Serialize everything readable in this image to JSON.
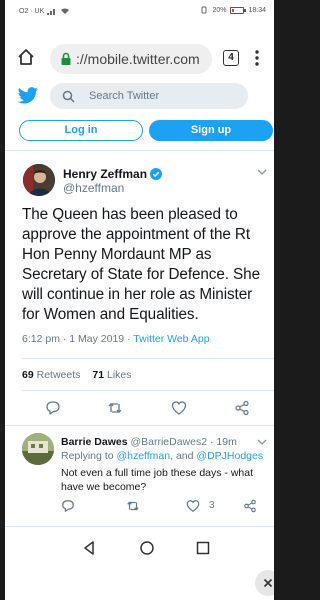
{
  "status_bar": {
    "carrier": "O2 · UK",
    "battery_percent_text": "20%",
    "battery_level": 0.2,
    "time": "18:34"
  },
  "browser": {
    "url": "://mobile.twitter.com",
    "tab_count": "4"
  },
  "twitter_header": {
    "search_placeholder": "Search Twitter",
    "login_label": "Log in",
    "signup_label": "Sign up"
  },
  "tweet": {
    "author_name": "Henry Zeffman",
    "author_handle": "@hzeffman",
    "text": "The Queen has been pleased to approve the appointment of the Rt Hon Penny Mordaunt MP as Secretary of State for Defence. She will continue in her role as Minister for Women and Equalities.",
    "timestamp": "6:12 pm · 1 May 2019 · ",
    "source": "Twitter Web App",
    "retweets_count": "69",
    "retweets_label": "Retweets",
    "likes_count": "71",
    "likes_label": "Likes"
  },
  "reply": {
    "author_name": "Barrie Dawes",
    "author_handle": "@BarrieDawes2 · 19m",
    "replying_prefix": "Replying to ",
    "mention_1": "@hzeffman",
    "replying_join": ", and ",
    "mention_2": "@DPJHodges",
    "text": "Not even a full time job these days - what have we become?",
    "like_count": "3"
  },
  "colors": {
    "twitter_blue": "#1da1f2",
    "text_primary": "#14171a",
    "text_secondary": "#657786"
  }
}
